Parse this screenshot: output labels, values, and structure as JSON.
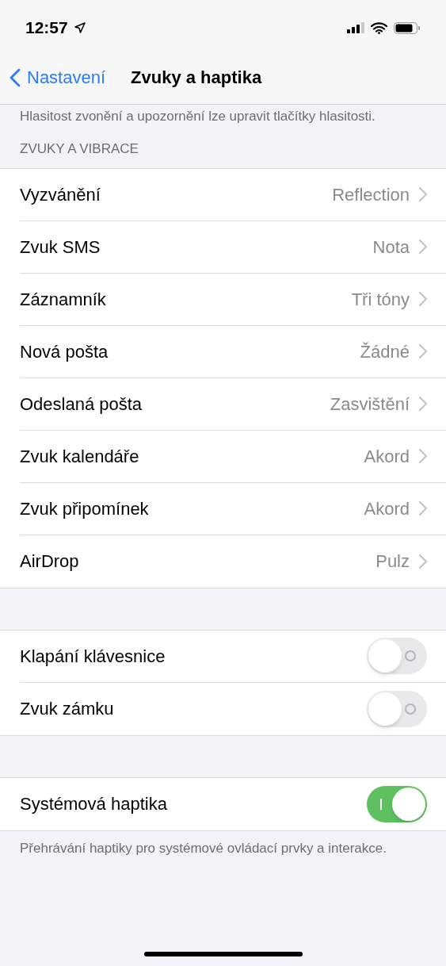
{
  "status_bar": {
    "time": "12:57"
  },
  "nav": {
    "back": "Nastavení",
    "title": "Zvuky a haptika"
  },
  "top_note": "Hlasitost zvonění a upozornění lze upravit tlačítky hlasitosti.",
  "sections": [
    {
      "header": "ZVUKY A VIBRACE",
      "rows": [
        {
          "kind": "link",
          "label": "Vyzvánění",
          "value": "Reflection"
        },
        {
          "kind": "link",
          "label": "Zvuk SMS",
          "value": "Nota"
        },
        {
          "kind": "link",
          "label": "Záznamník",
          "value": "Tři tóny"
        },
        {
          "kind": "link",
          "label": "Nová pošta",
          "value": "Žádné"
        },
        {
          "kind": "link",
          "label": "Odeslaná pošta",
          "value": "Zasvištění"
        },
        {
          "kind": "link",
          "label": "Zvuk kalendáře",
          "value": "Akord"
        },
        {
          "kind": "link",
          "label": "Zvuk připomínek",
          "value": "Akord"
        },
        {
          "kind": "link",
          "label": "AirDrop",
          "value": "Pulz"
        }
      ]
    },
    {
      "rows": [
        {
          "kind": "toggle",
          "label": "Klapání klávesnice",
          "on": false
        },
        {
          "kind": "toggle",
          "label": "Zvuk zámku",
          "on": false
        }
      ]
    },
    {
      "rows": [
        {
          "kind": "toggle",
          "label": "Systémová haptika",
          "on": true
        }
      ],
      "footer": "Přehrávání haptiky pro systémové ovládací prvky a interakce."
    }
  ]
}
